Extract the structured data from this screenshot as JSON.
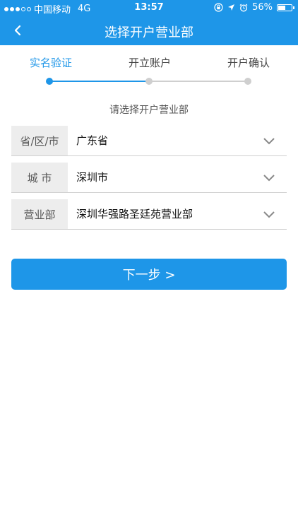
{
  "status_bar": {
    "carrier": "中国移动",
    "network": "4G",
    "time": "13:57",
    "battery": "56%",
    "battery_level": 0.56,
    "signal_bars_filled": 3,
    "signal_bars_total": 5
  },
  "nav": {
    "title": "选择开户营业部"
  },
  "steps": [
    {
      "label": "实名验证",
      "state": "active"
    },
    {
      "label": "开立账户",
      "state": "inactive"
    },
    {
      "label": "开户确认",
      "state": "inactive"
    }
  ],
  "form": {
    "prompt": "请选择开户营业部",
    "rows": [
      {
        "label": "省/区/市",
        "value": "广东省"
      },
      {
        "label": "城 市",
        "value": "深圳市"
      },
      {
        "label": "营业部",
        "value": "深圳华强路圣廷苑营业部"
      }
    ]
  },
  "next_button": {
    "label": "下一步 >"
  },
  "colors": {
    "primary": "#1e96e8",
    "inactive": "#cfcfcf",
    "label_bg": "#ededed"
  },
  "icons": [
    "back-chevron-icon",
    "rotation-lock-icon",
    "location-arrow-icon",
    "alarm-icon",
    "battery-icon",
    "chevron-down-icon"
  ]
}
